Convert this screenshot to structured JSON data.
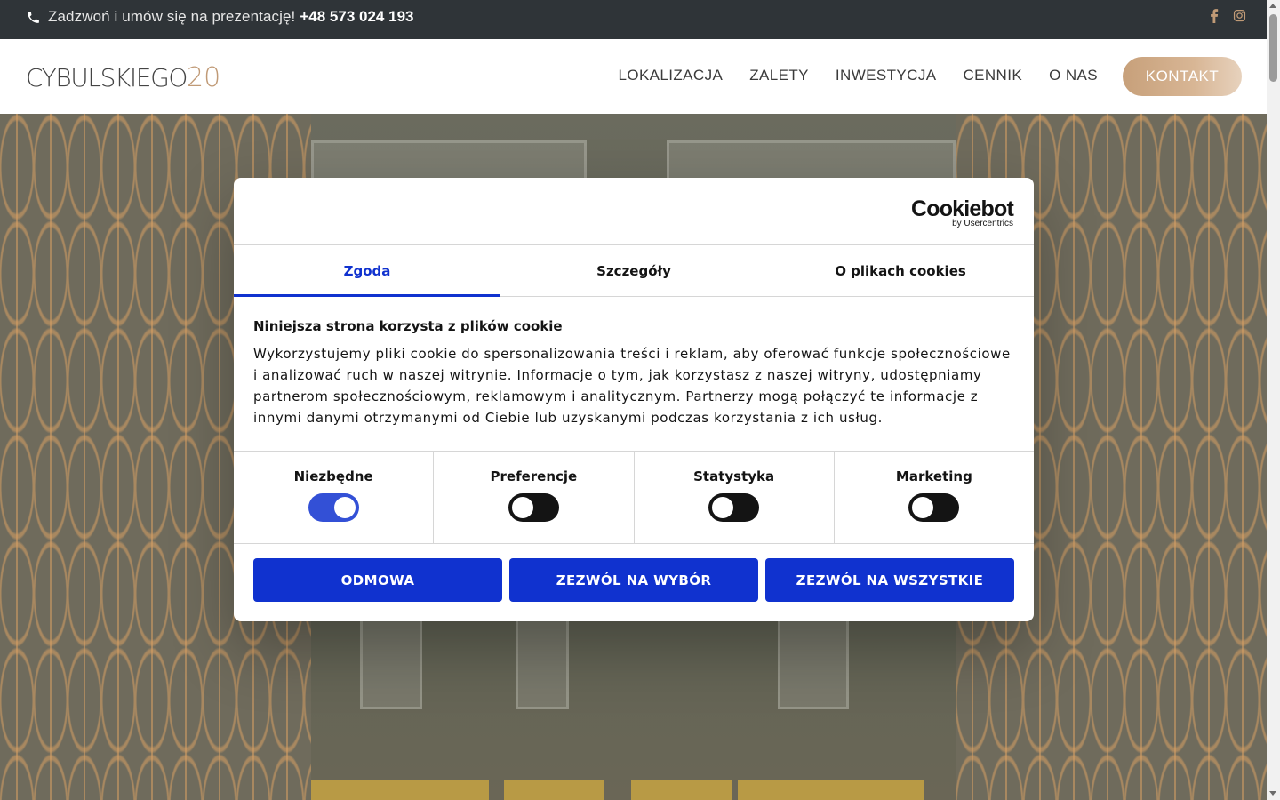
{
  "topbar": {
    "call_text": "Zadzwoń i umów się na prezentację!",
    "phone_number": "+48 573 024 193",
    "social_icons": [
      "facebook-icon",
      "instagram-icon"
    ],
    "icon_color": "#c09a76"
  },
  "header": {
    "logo_text": "CYBULSKIEGO",
    "logo_number": "20",
    "nav": [
      "LOKALIZACJA",
      "ZALETY",
      "INWESTYCJA",
      "CENNIK",
      "O NAS"
    ],
    "contact_label": "KONTAKT"
  },
  "cookie_dialog": {
    "brand": "Cookiebot",
    "brand_by": "by Usercentrics",
    "tabs": [
      "Zgoda",
      "Szczegóły",
      "O plikach cookies"
    ],
    "active_tab": "Zgoda",
    "heading": "Niniejsza strona korzysta z plików cookie",
    "description": "Wykorzystujemy pliki cookie do spersonalizowania treści i reklam, aby oferować funkcje społecznościowe i analizować ruch w naszej witrynie. Informacje o tym, jak korzystasz z naszej witryny, udostępniamy partnerom społecznościowym, reklamowym i analitycznym. Partnerzy mogą połączyć te informacje z innymi danymi otrzymanymi od Ciebie lub uzyskanymi podczas korzystania z ich usług.",
    "toggles": [
      {
        "label": "Niezbędne",
        "on": true
      },
      {
        "label": "Preferencje",
        "on": false
      },
      {
        "label": "Statystyka",
        "on": false
      },
      {
        "label": "Marketing",
        "on": false
      }
    ],
    "buttons": {
      "deny": "ODMOWA",
      "allow_selection": "ZEZWÓL NA WYBÓR",
      "allow_all": "ZEZWÓL NA WSZYSTKIE"
    },
    "accent_color": "#1032cf"
  }
}
